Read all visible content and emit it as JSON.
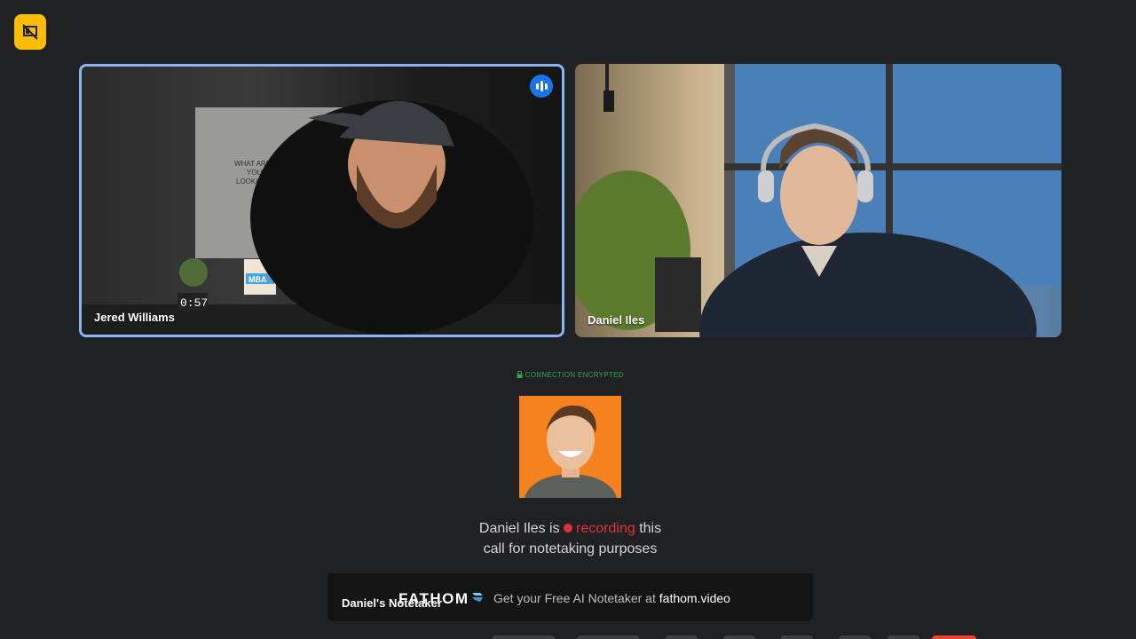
{
  "participants": [
    {
      "name": "Jered Williams"
    },
    {
      "name": "Daniel Iles"
    }
  ],
  "scene_text": {
    "poster": "WHAT ARE YOU LOOKING AT?",
    "book": "MBA",
    "clock": "0:57"
  },
  "notetaker": {
    "encrypted_label": "CONNECTION ENCRYPTED",
    "recording_prefix": "Daniel Iles is",
    "recording_word": "recording",
    "recording_suffix_1": "this",
    "recording_line_2": "call for notetaking purposes",
    "tile_name": "Daniel's Notetaker",
    "brand": "FATHOM",
    "cta_text": "Get your Free AI Notetaker at",
    "cta_link": "fathom.video"
  },
  "icons": {
    "badge": "presentation-off-icon",
    "speaking": "speaking-indicator-icon",
    "lock": "lock-icon"
  },
  "colors": {
    "active_speaker_border": "#8ab4f8",
    "recording": "#e0323b",
    "encrypted": "#34a853",
    "badge": "#fbbc04"
  }
}
